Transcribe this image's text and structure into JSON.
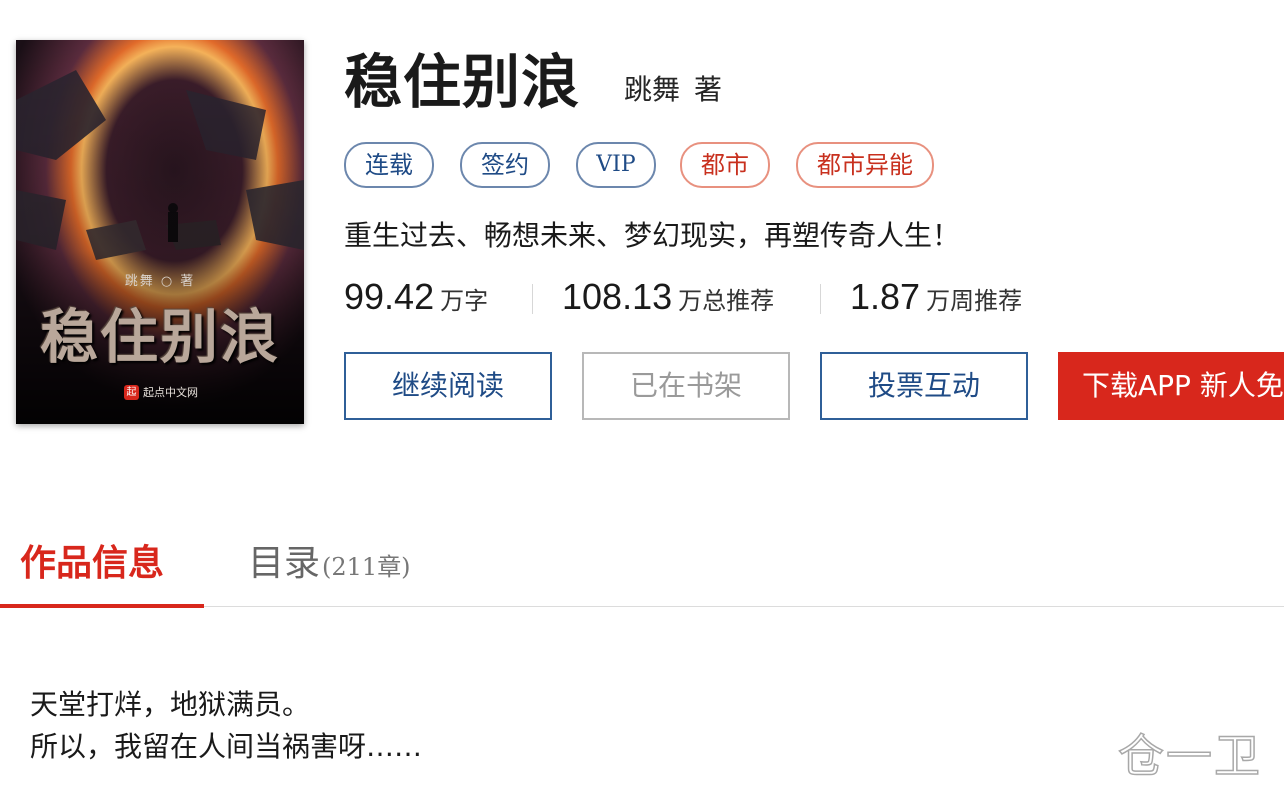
{
  "book": {
    "title": "稳住别浪",
    "author_name": "跳舞",
    "author_suffix": "著",
    "tags": [
      {
        "label": "连载",
        "color": "blue"
      },
      {
        "label": "签约",
        "color": "blue"
      },
      {
        "label": "VIP",
        "color": "blue"
      },
      {
        "label": "都市",
        "color": "red"
      },
      {
        "label": "都市异能",
        "color": "red"
      }
    ],
    "intro": "重生过去、畅想未来、梦幻现实，再塑传奇人生！",
    "stats": [
      {
        "value": "99.42",
        "unit": "万字"
      },
      {
        "value": "108.13",
        "unit": "万总推荐"
      },
      {
        "value": "1.87",
        "unit": "万周推荐"
      }
    ]
  },
  "cover": {
    "author_line": "跳舞 ○ 著",
    "title": "稳住别浪",
    "publisher_mark": "起",
    "publisher": "起点中文网"
  },
  "actions": {
    "read_label": "继续阅读",
    "shelf_label": "已在书架",
    "vote_label": "投票互动",
    "app_label": "下载APP 新人免费"
  },
  "tabs": {
    "info_label": "作品信息",
    "toc_label": "目录",
    "toc_count": "(211章)"
  },
  "description": {
    "lines": [
      "天堂打烊，地狱满员。",
      "所以，我留在人间当祸害呀……"
    ]
  },
  "watermark": "仓一卫",
  "colors": {
    "accent_red": "#d8271c",
    "link_blue": "#1f4b86",
    "tag_blue_border": "#6c87ad",
    "tag_red_border": "#e8917f"
  }
}
